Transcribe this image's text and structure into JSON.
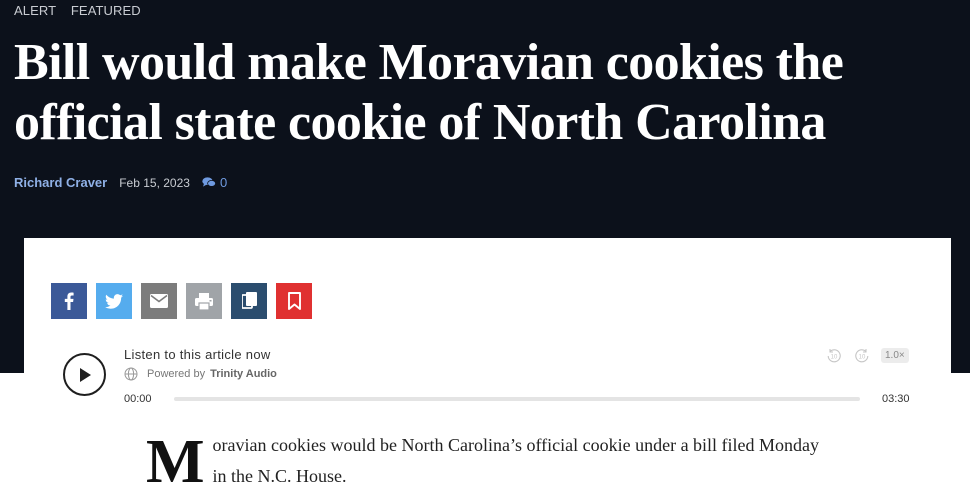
{
  "tags": [
    "ALERT",
    "FEATURED"
  ],
  "headline": "Bill would make Moravian cookies the official state cookie of North Carolina",
  "byline": {
    "author": "Richard Craver",
    "date": "Feb 15, 2023",
    "comment_count": "0"
  },
  "share": {
    "icons": [
      "facebook-icon",
      "twitter-icon",
      "email-icon",
      "print-icon",
      "copy-icon",
      "bookmark-icon"
    ],
    "colors": {
      "facebook": "#3b5998",
      "twitter": "#55acee",
      "email": "#7c7c7c",
      "print": "#a0a4a8",
      "copy": "#2b4d6e",
      "bookmark": "#e03131"
    }
  },
  "audio": {
    "title": "Listen to this article now",
    "powered_by": "Powered by",
    "provider": "Trinity Audio",
    "current_time": "00:00",
    "total_time": "03:30",
    "speed": "1.0×",
    "rewind_label": "10",
    "forward_label": "10",
    "progress": 0
  },
  "article": {
    "dropcap": "M",
    "first_paragraph_rest": "oravian cookies would be North Carolina’s official cookie under a bill filed Monday in the N.C. House."
  }
}
